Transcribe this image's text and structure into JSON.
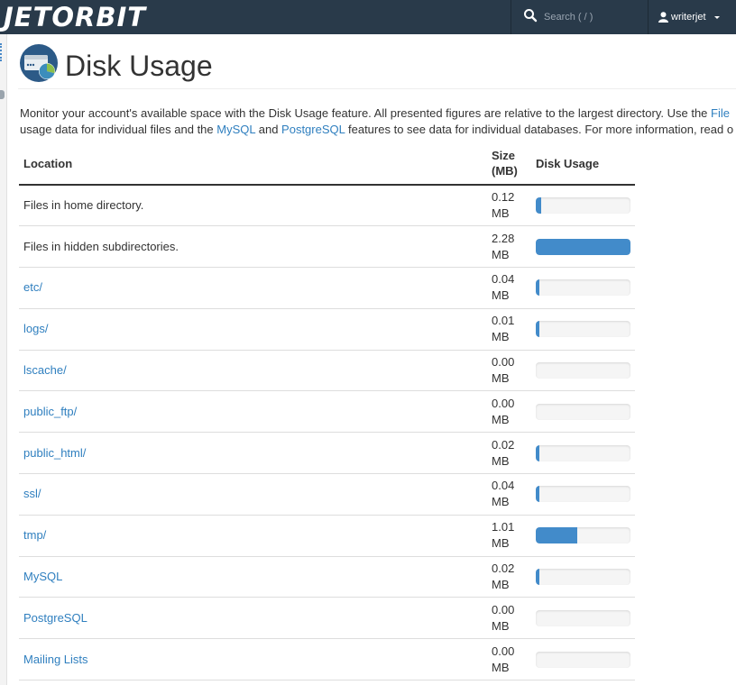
{
  "brand": {
    "logo_text": "JETORBIT"
  },
  "topbar": {
    "search_placeholder": "Search ( / )",
    "username": "writerjet"
  },
  "page": {
    "title": "Disk Usage",
    "desc_line1_pre": "Monitor your account's available space with the Disk Usage feature. All presented figures are relative to the largest directory. Use the ",
    "desc_link_file": "File",
    "desc_line2_pre": "usage data for individual files and the ",
    "desc_link_mysql": "MySQL",
    "desc_and": " and ",
    "desc_link_postgres": "PostgreSQL",
    "desc_line2_post": " features to see data for individual databases. For more information, read o"
  },
  "table": {
    "headers": {
      "location": "Location",
      "size_l1": "Size",
      "size_l2": "(MB)",
      "disk_usage": "Disk Usage"
    },
    "rows": [
      {
        "location": "Files in home directory.",
        "link": false,
        "size": "0.12",
        "unit": "MB",
        "usage_fraction": 0.053
      },
      {
        "location": "Files in hidden subdirectories.",
        "link": false,
        "size": "2.28",
        "unit": "MB",
        "usage_fraction": 1.0
      },
      {
        "location": "etc/",
        "link": true,
        "size": "0.04",
        "unit": "MB",
        "usage_fraction": 0.018
      },
      {
        "location": "logs/",
        "link": true,
        "size": "0.01",
        "unit": "MB",
        "usage_fraction": 0.004
      },
      {
        "location": "lscache/",
        "link": true,
        "size": "0.00",
        "unit": "MB",
        "usage_fraction": 0.0
      },
      {
        "location": "public_ftp/",
        "link": true,
        "size": "0.00",
        "unit": "MB",
        "usage_fraction": 0.0
      },
      {
        "location": "public_html/",
        "link": true,
        "size": "0.02",
        "unit": "MB",
        "usage_fraction": 0.009
      },
      {
        "location": "ssl/",
        "link": true,
        "size": "0.04",
        "unit": "MB",
        "usage_fraction": 0.018
      },
      {
        "location": "tmp/",
        "link": true,
        "size": "1.01",
        "unit": "MB",
        "usage_fraction": 0.443
      },
      {
        "location": "MySQL",
        "link": true,
        "size": "0.02",
        "unit": "MB",
        "usage_fraction": 0.009
      },
      {
        "location": "PostgreSQL",
        "link": true,
        "size": "0.00",
        "unit": "MB",
        "usage_fraction": 0.0
      },
      {
        "location": "Mailing Lists",
        "link": true,
        "size": "0.00",
        "unit": "MB",
        "usage_fraction": 0.0
      }
    ]
  },
  "colors": {
    "topbar": "#293a4a",
    "link": "#2f7fbf",
    "bar_fill": "#428bca",
    "bar_track": "#f5f5f5"
  }
}
